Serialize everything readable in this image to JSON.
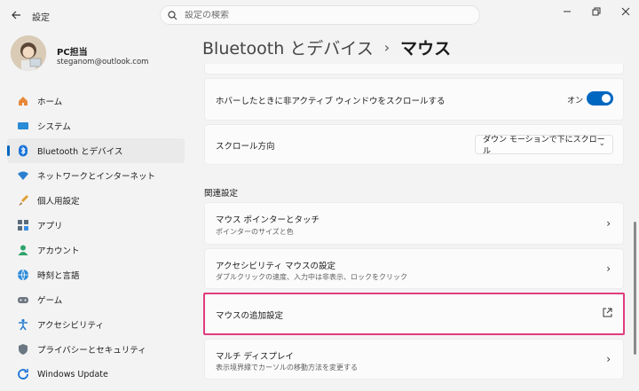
{
  "window": {
    "title": "設定"
  },
  "search": {
    "placeholder": "設定の検索"
  },
  "profile": {
    "name": "PC担当",
    "email": "steganom@outlook.com"
  },
  "sidebar": {
    "items": [
      {
        "label": "ホーム",
        "icon": "home-icon"
      },
      {
        "label": "システム",
        "icon": "system-icon"
      },
      {
        "label": "Bluetooth とデバイス",
        "icon": "bluetooth-icon",
        "active": true
      },
      {
        "label": "ネットワークとインターネット",
        "icon": "wifi-icon"
      },
      {
        "label": "個人用設定",
        "icon": "brush-icon"
      },
      {
        "label": "アプリ",
        "icon": "apps-icon"
      },
      {
        "label": "アカウント",
        "icon": "account-icon"
      },
      {
        "label": "時刻と言語",
        "icon": "globe-icon"
      },
      {
        "label": "ゲーム",
        "icon": "game-icon"
      },
      {
        "label": "アクセシビリティ",
        "icon": "accessibility-icon"
      },
      {
        "label": "プライバシーとセキュリティ",
        "icon": "shield-icon"
      },
      {
        "label": "Windows Update",
        "icon": "update-icon"
      }
    ]
  },
  "breadcrumb": {
    "parent": "Bluetooth とデバイス",
    "separator": "›",
    "current": "マウス"
  },
  "settings": {
    "hover_scroll": {
      "label": "ホバーしたときに非アクティブ ウィンドウをスクロールする",
      "state": "オン",
      "on": true
    },
    "scroll_direction": {
      "label": "スクロール方向",
      "value": "ダウン モーションで下にスクロール"
    }
  },
  "related": {
    "heading": "関連設定",
    "items": [
      {
        "title": "マウス ポインターとタッチ",
        "desc": "ポインターのサイズと色"
      },
      {
        "title": "アクセシビリティ マウスの設定",
        "desc": "ダブルクリックの速度、入力中は非表示、ロックをクリック"
      },
      {
        "title": "マウスの追加設定",
        "desc": ""
      },
      {
        "title": "マルチ ディスプレイ",
        "desc": "表示境界縁でカーソルの移動方法を変更する"
      }
    ]
  },
  "colors": {
    "accent": "#0067c0",
    "highlight": "#e23b7e",
    "background": "#f3f3f3",
    "card": "#fbfbfb"
  }
}
